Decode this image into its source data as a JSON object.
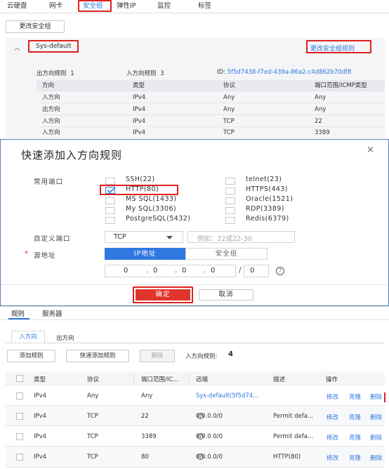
{
  "top_tabs": [
    "云硬盘",
    "网卡",
    "安全组",
    "弹性IP",
    "监控",
    "标签"
  ],
  "change_sg_button": "更改安全组",
  "sg_name": "Sys-default",
  "change_sg_rules": "更改安全组规则",
  "summary": {
    "outbound_label": "出方向规则",
    "outbound_count": "1",
    "inbound_label": "入方向规则",
    "inbound_count": "3",
    "id_label": "ID:",
    "id_value": "5f5d7438-f7ed-439a-86a2-c4d862b70df8"
  },
  "p1_table": {
    "headers": [
      "方向",
      "类型",
      "协议",
      "端口范围/ICMP类型"
    ],
    "rows": [
      [
        "入方向",
        "IPv4",
        "Any",
        "Any"
      ],
      [
        "出方向",
        "IPv4",
        "Any",
        "Any"
      ],
      [
        "入方向",
        "IPv4",
        "TCP",
        "22"
      ],
      [
        "入方向",
        "IPv4",
        "TCP",
        "3389"
      ]
    ]
  },
  "dialog": {
    "title": "快速添加入方向规则",
    "close": "×",
    "common_ports_label": "常用端口",
    "ports_left": [
      {
        "label": "SSH(22)",
        "checked": false
      },
      {
        "label": "HTTP(80)",
        "checked": true
      },
      {
        "label": "MS SQL(1433)",
        "checked": false
      },
      {
        "label": "My SQL(3306)",
        "checked": false
      },
      {
        "label": "PostgreSQL(5432)",
        "checked": false
      }
    ],
    "ports_right": [
      {
        "label": "telnet(23)",
        "checked": false
      },
      {
        "label": "HTTPS(443)",
        "checked": false
      },
      {
        "label": "Oracle(1521)",
        "checked": false
      },
      {
        "label": "RDP(3389)",
        "checked": false
      },
      {
        "label": "Redis(6379)",
        "checked": false
      }
    ],
    "custom_port_label": "自定义端口",
    "protocol_value": "TCP",
    "port_placeholder": "例如：22或22-30",
    "source_label": "源地址",
    "source_tabs": [
      "IP地址",
      "安全组"
    ],
    "ip_octets": [
      "0",
      "0",
      "0",
      "0"
    ],
    "mask_value": "0",
    "confirm": "确定",
    "cancel": "取消"
  },
  "p3": {
    "tabs": [
      "规则",
      "服务器"
    ],
    "subtabs": [
      "入方向",
      "出方向"
    ],
    "add_rule": "添加规则",
    "quick_add": "快速添加规则",
    "delete": "删除",
    "inbound_rules_label": "入方向规则:",
    "inbound_rules_count": "4",
    "headers": [
      "类型",
      "协议",
      "端口范围/IC...",
      "远端",
      "描述",
      "操作"
    ],
    "rows": [
      {
        "type": "IPv4",
        "proto": "Any",
        "port": "Any",
        "remote": "Sys-default(5f5d74...",
        "desc": ""
      },
      {
        "type": "IPv4",
        "proto": "TCP",
        "port": "22",
        "remote": "0.0.0.0/0",
        "desc": "Permit defa..."
      },
      {
        "type": "IPv4",
        "proto": "TCP",
        "port": "3389",
        "remote": "0.0.0.0/0",
        "desc": "Permit defa..."
      },
      {
        "type": "IPv4",
        "proto": "TCP",
        "port": "80",
        "remote": "0.0.0.0/0",
        "desc": "HTTP(80)"
      }
    ],
    "actions": [
      "修改",
      "克隆",
      "删除"
    ]
  },
  "colors": {
    "accent": "#2f78e0",
    "highlight": "#e02020",
    "confirm_bg": "#e0352b"
  }
}
